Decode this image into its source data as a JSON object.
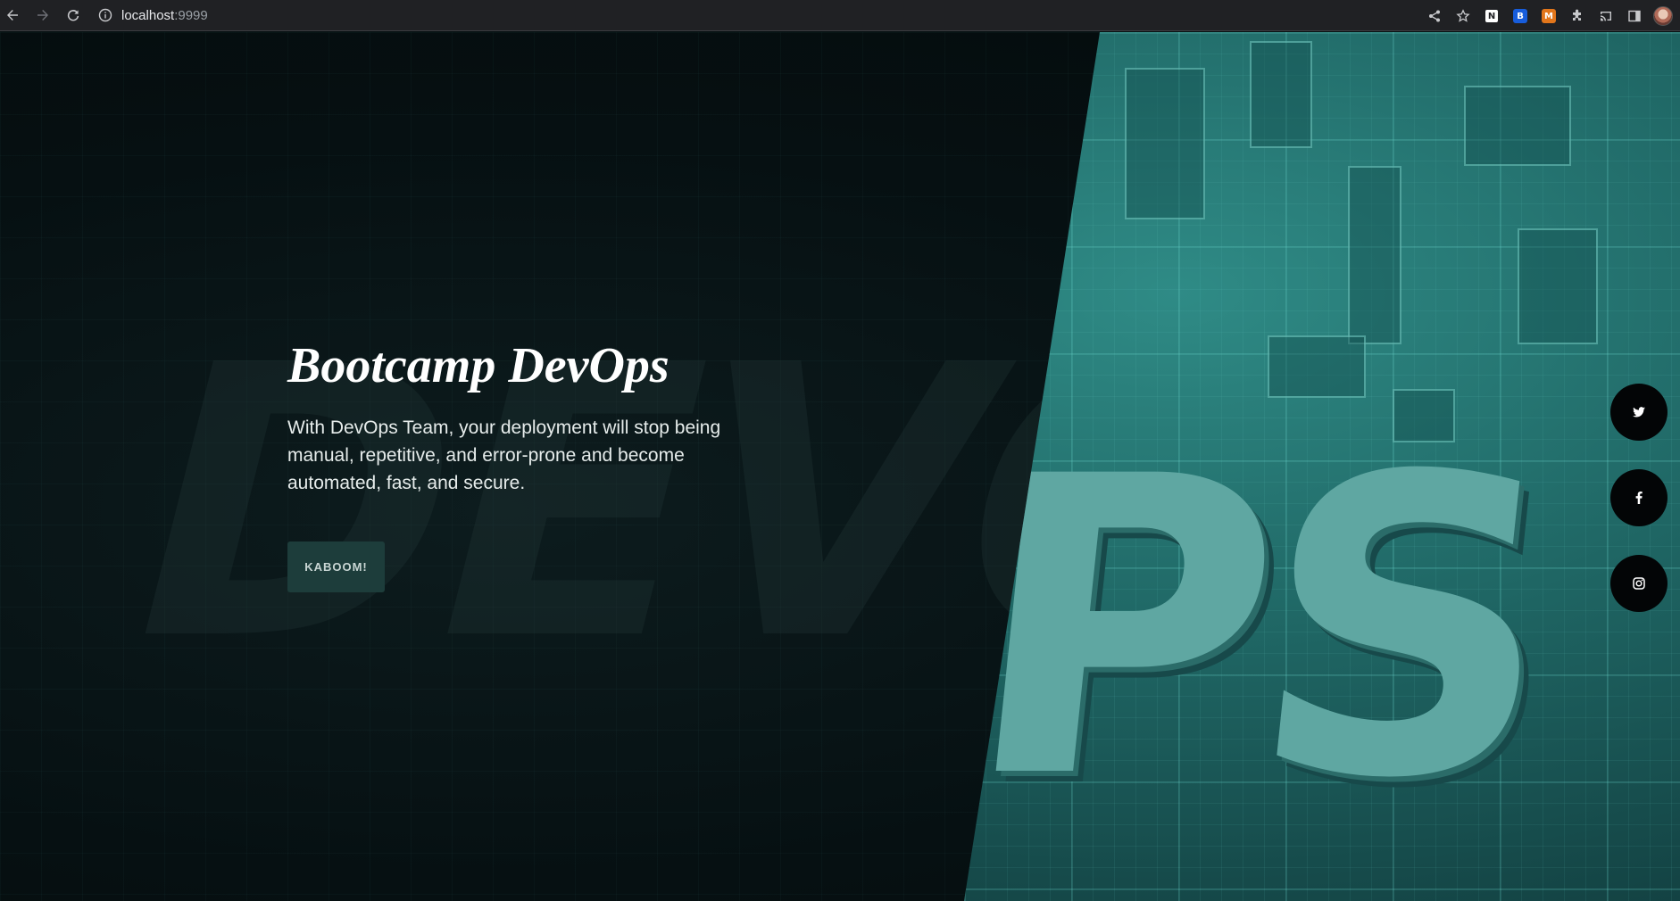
{
  "browser": {
    "address_host": "localhost",
    "address_port": ":9999",
    "icons": [
      "back-icon",
      "forward-icon",
      "reload-icon",
      "info-icon",
      "share-icon",
      "star-icon",
      "puzzle-icon",
      "cast-icon",
      "sidebar-icon",
      "avatar"
    ],
    "extensions": [
      {
        "name": "notion-extension-icon",
        "glyph": "N",
        "bg": "#ffffff",
        "fg": "#202124"
      },
      {
        "name": "bitwarden-extension-icon",
        "glyph": "B",
        "bg": "#175ddc",
        "fg": "#ffffff"
      },
      {
        "name": "metamask-extension-icon",
        "glyph": "M",
        "bg": "#e2761b",
        "fg": "#ffffff"
      }
    ]
  },
  "hero": {
    "title": "Bootcamp DevOps",
    "description": "With DevOps Team, your deployment will stop being manual, repetitive, and error-prone and become automated, fast, and secure.",
    "cta_label": "KABOOM!",
    "background_word_left": "DEVO",
    "background_word_right": "PS",
    "colors": {
      "dark_bg": "#071012",
      "teal_panel": "#2f8b86",
      "button_bg": "#1d3d3b",
      "social_bg": "#030506"
    }
  },
  "social": [
    {
      "name": "twitter",
      "icon": "twitter-icon"
    },
    {
      "name": "facebook",
      "icon": "facebook-icon"
    },
    {
      "name": "instagram",
      "icon": "instagram-icon"
    }
  ]
}
